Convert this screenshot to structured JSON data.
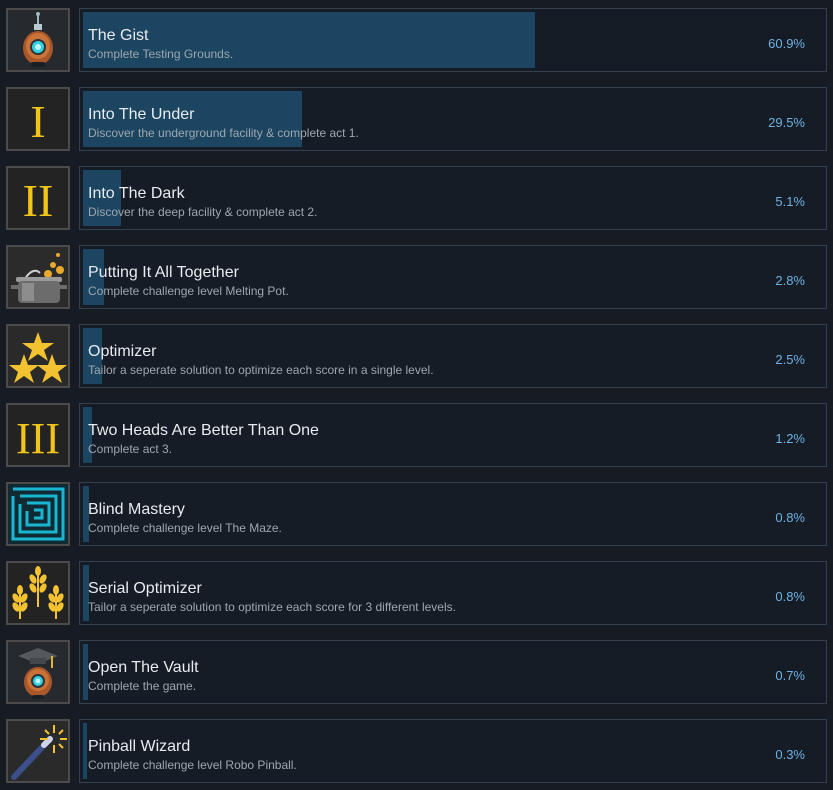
{
  "achievements": [
    {
      "title": "The Gist",
      "description": "Complete Testing Grounds.",
      "percent_label": "60.9%",
      "percent": 60.9,
      "icon": "robot-icon"
    },
    {
      "title": "Into The Under",
      "description": "Discover the underground facility & complete act 1.",
      "percent_label": "29.5%",
      "percent": 29.5,
      "icon": "roman-numeral-one-icon"
    },
    {
      "title": "Into The Dark",
      "description": "Discover the deep facility & complete act 2.",
      "percent_label": "5.1%",
      "percent": 5.1,
      "icon": "roman-numeral-two-icon"
    },
    {
      "title": "Putting It All Together",
      "description": "Complete challenge level Melting Pot.",
      "percent_label": "2.8%",
      "percent": 2.8,
      "icon": "melting-pot-icon"
    },
    {
      "title": "Optimizer",
      "description": "Tailor a seperate solution to optimize each score in a single level.",
      "percent_label": "2.5%",
      "percent": 2.5,
      "icon": "three-stars-icon"
    },
    {
      "title": "Two Heads Are Better Than One",
      "description": "Complete act 3.",
      "percent_label": "1.2%",
      "percent": 1.2,
      "icon": "roman-numeral-three-icon"
    },
    {
      "title": "Blind Mastery",
      "description": "Complete challenge level The Maze.",
      "percent_label": "0.8%",
      "percent": 0.8,
      "icon": "maze-icon"
    },
    {
      "title": "Serial Optimizer",
      "description": "Tailor a seperate solution to optimize each score for 3 different levels.",
      "percent_label": "0.8%",
      "percent": 0.8,
      "icon": "wheat-icon"
    },
    {
      "title": "Open The Vault",
      "description": "Complete the game.",
      "percent_label": "0.7%",
      "percent": 0.7,
      "icon": "graduate-robot-icon"
    },
    {
      "title": "Pinball Wizard",
      "description": "Complete challenge level Robo Pinball.",
      "percent_label": "0.3%",
      "percent": 0.3,
      "icon": "magic-wand-icon"
    }
  ]
}
